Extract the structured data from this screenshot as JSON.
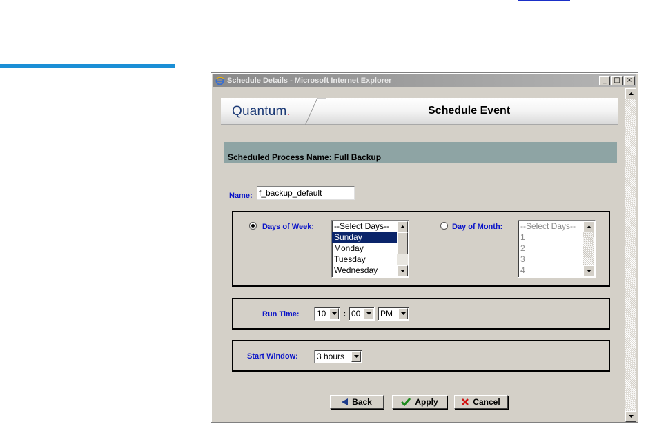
{
  "window": {
    "title": "Schedule Details - Microsoft Internet Explorer",
    "minimize": "_",
    "maximize": "□",
    "close": "×"
  },
  "banner": {
    "logo": "Quantum",
    "logo_dot": ".",
    "title": "Schedule Event"
  },
  "process": {
    "heading": "Scheduled Process Name: Full Backup"
  },
  "form": {
    "name_label": "Name:",
    "name_value": "f_backup_default",
    "days_of_week_label": "Days of Week:",
    "days_of_week_options": [
      "--Select Days--",
      "Sunday",
      "Monday",
      "Tuesday",
      "Wednesday"
    ],
    "days_of_week_selected": "Sunday",
    "day_of_month_label": "Day of Month:",
    "day_of_month_options": [
      "--Select Days--",
      "1",
      "2",
      "3",
      "4"
    ],
    "run_time_label": "Run Time:",
    "run_time_hour": "10",
    "run_time_separator": ":",
    "run_time_minute": "00",
    "run_time_ampm": "PM",
    "start_window_label": "Start Window:",
    "start_window_value": "3 hours"
  },
  "buttons": {
    "back": "Back",
    "apply": "Apply",
    "cancel": "Cancel"
  },
  "colors": {
    "label_blue": "#0a14c8",
    "header_bar": "#8ea4a4",
    "selection": "#0a246a",
    "accent_rule": "#1b8fd6"
  }
}
